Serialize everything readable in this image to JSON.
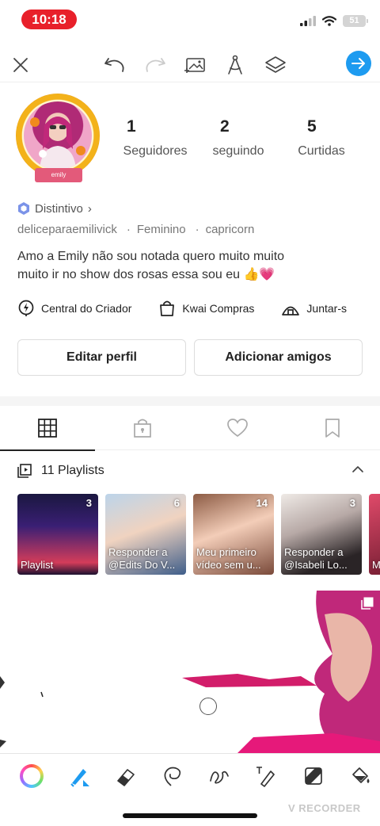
{
  "status_bar": {
    "time": "10:18",
    "battery": "51"
  },
  "toolbar": {
    "icons": [
      "close-icon",
      "undo-icon",
      "redo-icon",
      "image-icon",
      "compass-icon",
      "layers-icon",
      "send-icon"
    ],
    "accent": "#1d9bf0"
  },
  "profile": {
    "avatar_banner": "emily",
    "stats": [
      {
        "value": "1",
        "label": "Seguidores"
      },
      {
        "value": "2",
        "label": "seguindo"
      },
      {
        "value": "5",
        "label": "Curtidas"
      }
    ],
    "badge": "Distintivo",
    "badge_arrow": "›",
    "username": "deliceparaemilivick",
    "gender": "Feminino",
    "sign": "capricorn",
    "bio_line1": "Amo a Emily não sou notada quero muito muito",
    "bio_line2": "muito ir no show dos rosas essa sou eu 👍💗"
  },
  "links": [
    {
      "label": "Central do Criador",
      "icon": "lightning-pin-icon"
    },
    {
      "label": "Kwai Compras",
      "icon": "shopping-bag-icon"
    },
    {
      "label": "Juntar-s",
      "icon": "tent-icon"
    }
  ],
  "buttons": {
    "edit": "Editar perfil",
    "add": "Adicionar amigos"
  },
  "tabs": [
    {
      "name": "grid",
      "icon": "grid-icon",
      "active": true
    },
    {
      "name": "private",
      "icon": "lock-bag-icon",
      "active": false
    },
    {
      "name": "likes",
      "icon": "heart-icon",
      "active": false
    },
    {
      "name": "saved",
      "icon": "bookmark-icon",
      "active": false
    }
  ],
  "playlists": {
    "title": "11 Playlists",
    "items": [
      {
        "count": "3",
        "title": "Playlist",
        "color": "#2b1a5c"
      },
      {
        "count": "6",
        "title": "Responder a @Edits Do V...",
        "color": "#6a8fb8"
      },
      {
        "count": "14",
        "title": "Meu primeiro vídeo sem u...",
        "color": "#c9a48f"
      },
      {
        "count": "3",
        "title": "Responder a @Isabeli Lo...",
        "color": "#8c7f86"
      },
      {
        "count": "",
        "title": "M",
        "color": "#c23b5a"
      }
    ]
  },
  "drawing_tools": [
    "color-wheel-icon",
    "pen-icon",
    "eraser-icon",
    "lasso-icon",
    "squiggle-icon",
    "text-pen-icon",
    "sticker-icon",
    "fill-bucket-icon"
  ],
  "watermark": "V RECORDER"
}
